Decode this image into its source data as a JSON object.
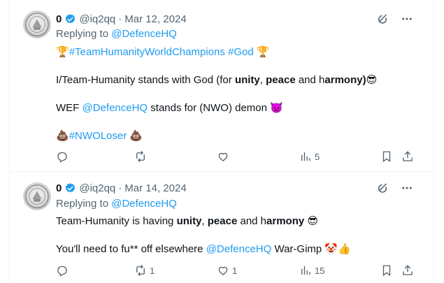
{
  "tweets": [
    {
      "name": "0",
      "handle": "@iq2qq",
      "dot": "·",
      "date": "Mar 12, 2024",
      "replying_prefix": "Replying to",
      "replying_to": "@DefenceHQ",
      "line1": {
        "emoji_a": "🏆",
        "tag1": "#TeamHumanityWorldChampions",
        "tag2": "#God",
        "emoji_b": "🏆"
      },
      "line2": {
        "a": "I/Team-Humanity stands with God (for ",
        "b1": "unity",
        "c": ", ",
        "b2": "peace",
        "d": " and h",
        "b3": "armony)",
        "emoji": "😎"
      },
      "line3": {
        "a": "WEF ",
        "mention": "@DefenceHQ",
        "b": " stands for (NWO) demon ",
        "emoji": "👿"
      },
      "line4": {
        "emoji_a": "💩",
        "tag": "#NWOLoser",
        "emoji_b": "💩"
      },
      "stats": {
        "replies": "",
        "reposts": "",
        "likes": "",
        "views": "5"
      }
    },
    {
      "name": "0",
      "handle": "@iq2qq",
      "dot": "·",
      "date": "Mar 14, 2024",
      "replying_prefix": "Replying to",
      "replying_to": "@DefenceHQ",
      "line1": {
        "a": "Team-Humanity is having ",
        "b1": "unity",
        "c": ", ",
        "b2": "peace",
        "d": " and h",
        "b3": "armony",
        "emoji": "😎"
      },
      "line2": {
        "a": "You'll need to fu** off elsewhere ",
        "mention": "@DefenceHQ",
        "b": " War-Gimp ",
        "emoji": "🤡👍"
      },
      "stats": {
        "replies": "",
        "reposts": "1",
        "likes": "1",
        "views": "15"
      }
    }
  ],
  "icons": [
    "avatar-seal",
    "verified-badge-icon",
    "grok-icon",
    "more-icon",
    "reply-icon",
    "repost-icon",
    "like-icon",
    "views-icon",
    "bookmark-icon",
    "share-icon"
  ],
  "colors": {
    "link": "#1d9bf0",
    "muted": "#536471",
    "text": "#0f1419",
    "border": "#eff3f4"
  }
}
